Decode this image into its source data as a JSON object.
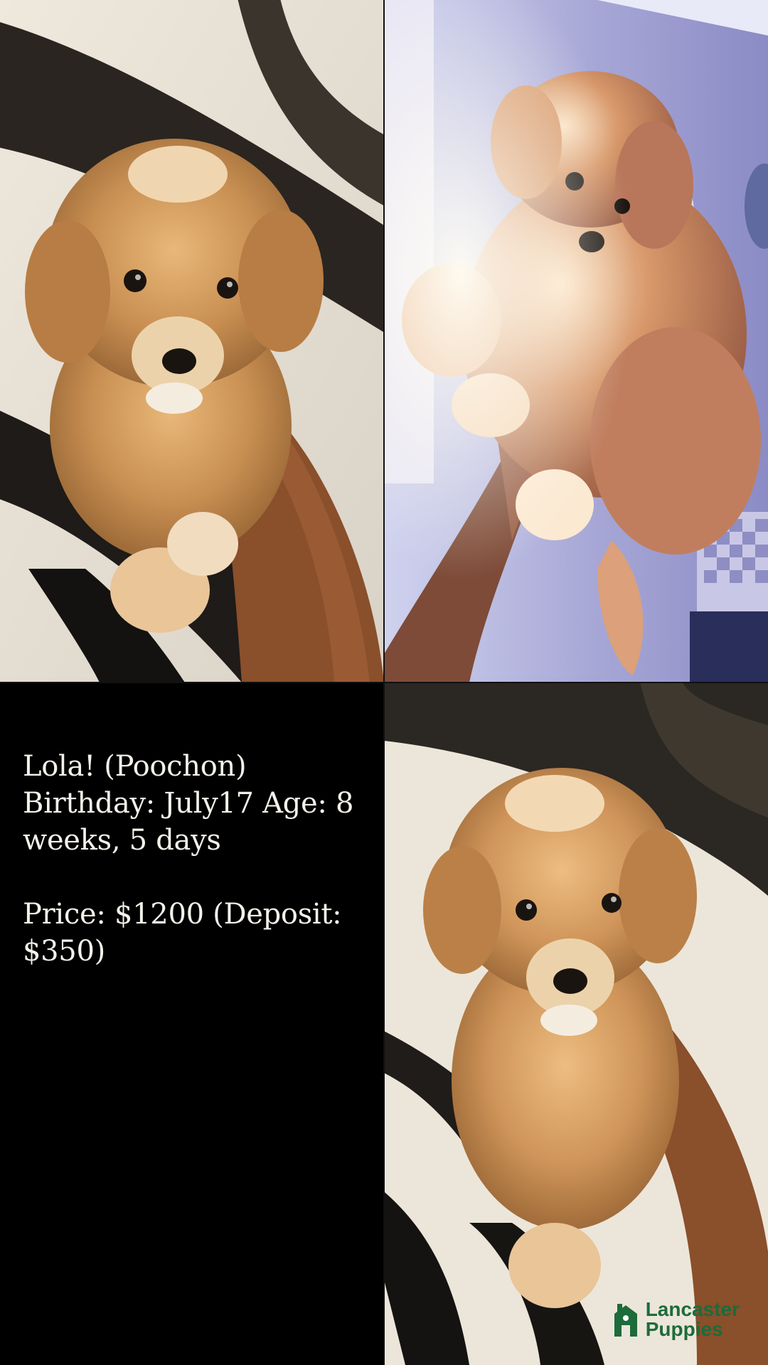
{
  "caption": {
    "line1": "Lola! (Poochon) Birthday: July17 Age: 8 weeks, 5 days",
    "line2": "Price: $1200 (Deposit: $350)"
  },
  "logo": {
    "word1": "Lancaster",
    "word2": "Puppies",
    "brand_color": "#1d6b3a"
  },
  "photos": [
    {
      "subject": "puppy-held-on-arm"
    },
    {
      "subject": "puppy-held-up-backlit"
    },
    {
      "subject": "puppy-held-on-arm-closeup"
    }
  ]
}
